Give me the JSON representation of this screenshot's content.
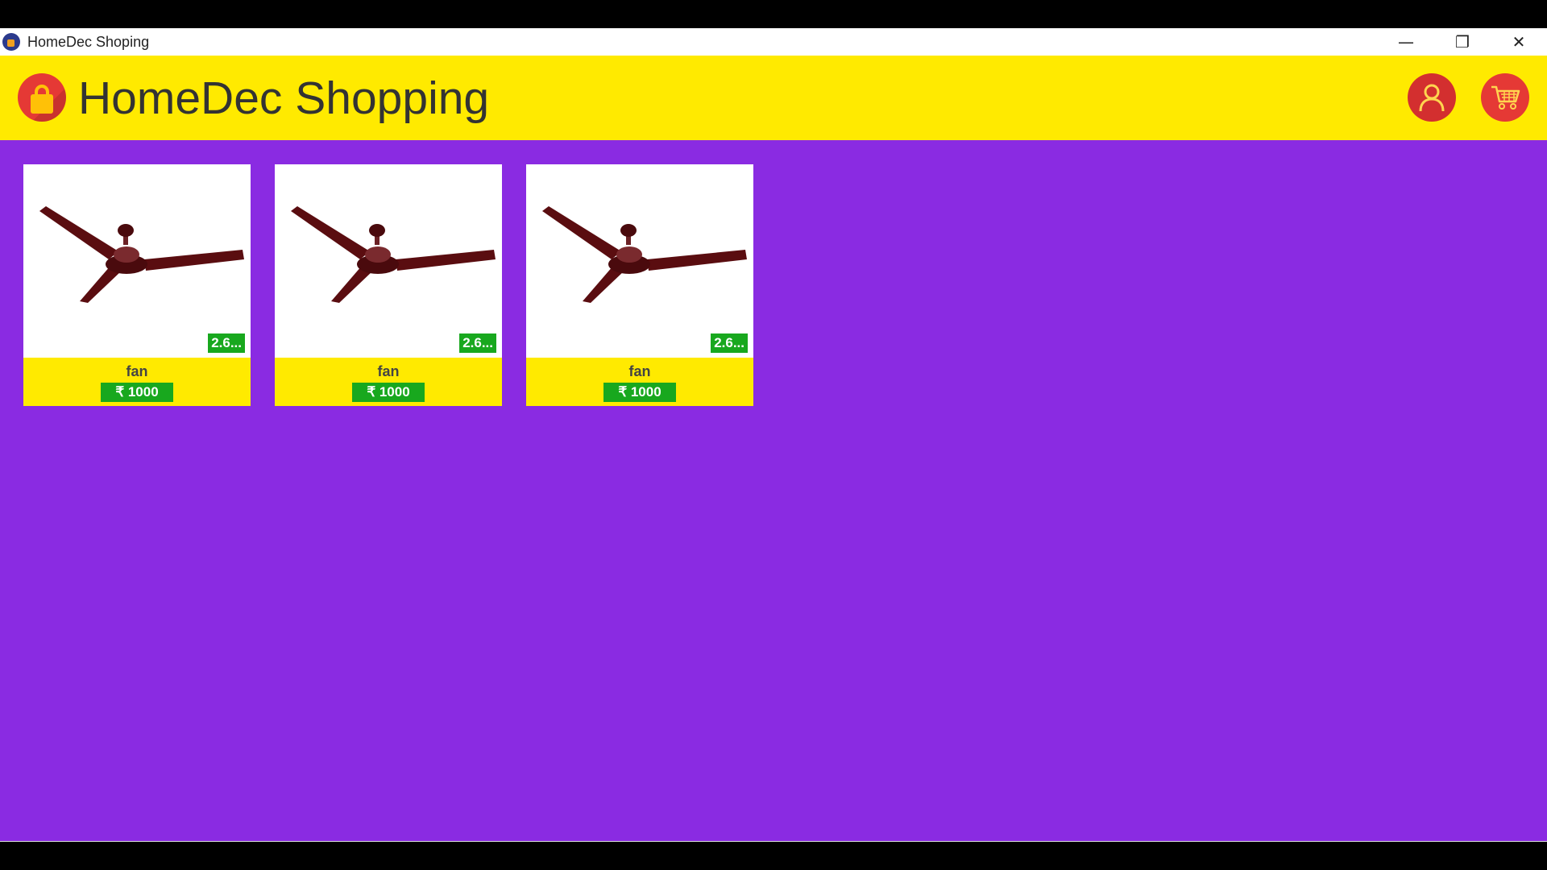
{
  "window": {
    "title": "HomeDec Shoping",
    "controls": {
      "minimize": "—",
      "restore": "❐",
      "close": "✕"
    }
  },
  "header": {
    "app_name": "HomeDec Shopping",
    "logo_icon": "shopping-bag-icon",
    "user_icon": "user-icon",
    "cart_icon": "cart-icon"
  },
  "colors": {
    "background": "#8a2be2",
    "header": "#ffea00",
    "accent_red": "#d32f2f",
    "badge_green": "#18a81e"
  },
  "products": [
    {
      "name": "fan",
      "price": "₹ 1000",
      "rating": "2.6...",
      "image_icon": "ceiling-fan-image"
    },
    {
      "name": "fan",
      "price": "₹ 1000",
      "rating": "2.6...",
      "image_icon": "ceiling-fan-image"
    },
    {
      "name": "fan",
      "price": "₹ 1000",
      "rating": "2.6...",
      "image_icon": "ceiling-fan-image"
    }
  ]
}
